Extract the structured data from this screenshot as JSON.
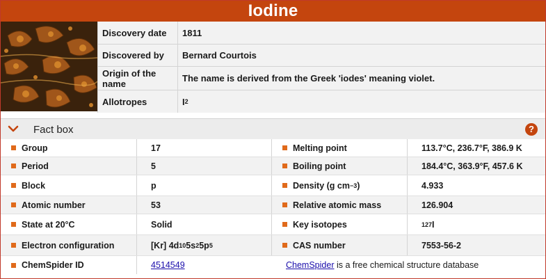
{
  "element_name": "Iodine",
  "overview": {
    "rows": [
      {
        "label": "Discovery date",
        "value": "1811"
      },
      {
        "label": "Discovered by",
        "value": "Bernard Courtois"
      },
      {
        "label": "Origin of the name",
        "value": "The name is derived from the Greek 'iodes' meaning violet."
      },
      {
        "label": "Allotropes",
        "value_base": "I",
        "value_sub": "2"
      }
    ]
  },
  "factbox": {
    "title": "Fact box",
    "help_glyph": "?",
    "rows": [
      {
        "left_label": "Group",
        "left_value": "17",
        "right_label": "Melting point",
        "right_value": "113.7°C, 236.7°F, 386.9 K"
      },
      {
        "left_label": "Period",
        "left_value": "5",
        "right_label": "Boiling point",
        "right_value": "184.4°C, 363.9°F, 457.6 K"
      },
      {
        "left_label": "Block",
        "left_value": "p",
        "right_label_base": "Density (g cm",
        "right_label_sup": "−3",
        "right_label_end": ")",
        "right_value": "4.933"
      },
      {
        "left_label": "Atomic number",
        "left_value": "53",
        "right_label": "Relative atomic mass",
        "right_value": "126.904"
      },
      {
        "left_label": "State at 20°C",
        "left_value": "Solid",
        "right_label": "Key isotopes",
        "right_value_sup": "127",
        "right_value_base": "I"
      },
      {
        "left_label": "Electron configuration",
        "config": {
          "a": "[Kr] 4d",
          "b": "10",
          "c": "5s",
          "d": "2",
          "e": "5p",
          "f": "5"
        },
        "right_label": "CAS number",
        "right_value": "7553-56-2"
      },
      {
        "left_label": "ChemSpider ID",
        "left_link": "4514549",
        "note_link": "ChemSpider",
        "note_text": " is a free chemical structure database"
      }
    ]
  },
  "colors": {
    "accent": "#c4450e",
    "bullet": "#e06a1b",
    "row_alt": "#f2f2f2",
    "link": "#1a0dab"
  },
  "icons": {
    "collapse": "chevron-down-icon",
    "help": "help-icon"
  }
}
